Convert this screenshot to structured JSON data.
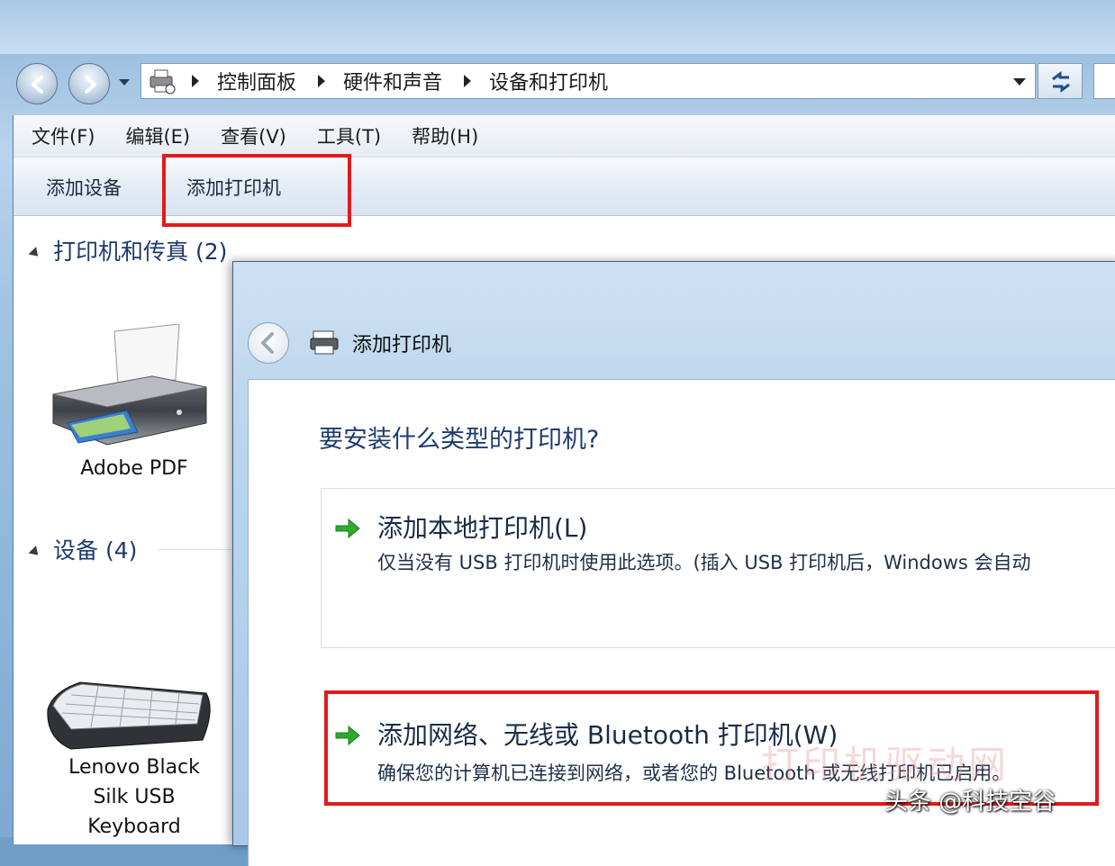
{
  "address_bar": {
    "breadcrumbs": [
      "控制面板",
      "硬件和声音",
      "设备和打印机"
    ]
  },
  "menu": {
    "items": [
      "文件(F)",
      "编辑(E)",
      "查看(V)",
      "工具(T)",
      "帮助(H)"
    ]
  },
  "toolbar": {
    "add_device": "添加设备",
    "add_printer": "添加打印机"
  },
  "groups": {
    "printers_header": "打印机和传真 (2)",
    "devices_header": "设备 (4)"
  },
  "devices": {
    "printer_label": "Adobe PDF",
    "keyboard_label_lines": [
      "Lenovo Black",
      "Silk USB",
      "Keyboard"
    ]
  },
  "dialog": {
    "title": "添加打印机",
    "question": "要安装什么类型的打印机?",
    "option_local": {
      "title": "添加本地打印机(L)",
      "description": "仅当没有 USB 打印机时使用此选项。(插入 USB 打印机后，Windows 会自动"
    },
    "option_network": {
      "title": "添加网络、无线或 Bluetooth 打印机(W)",
      "description": "确保您的计算机已连接到网络，或者您的 Bluetooth 或无线打印机已启用。"
    }
  },
  "overlay": {
    "watermark": "打印机驱动网",
    "credit": "头条 @科技空谷"
  },
  "colors": {
    "highlight": "#e01b1b",
    "arrow_green": "#2eaa2e",
    "link_text": "#1a2b48"
  }
}
